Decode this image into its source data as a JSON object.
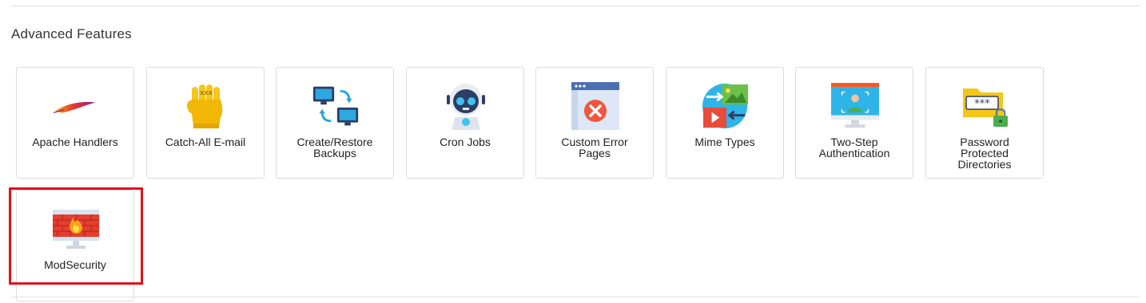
{
  "section": {
    "title": "Advanced Features"
  },
  "tiles": [
    {
      "label": "Apache Handlers",
      "icon": "apache-feather-icon"
    },
    {
      "label": "Catch-All E-mail",
      "icon": "catch-all-hand-icon"
    },
    {
      "label": "Create/Restore\nBackups",
      "icon": "backup-computers-icon"
    },
    {
      "label": "Cron Jobs",
      "icon": "cron-robot-icon"
    },
    {
      "label": "Custom Error\nPages",
      "icon": "error-page-icon"
    },
    {
      "label": "Mime Types",
      "icon": "mime-types-icon"
    },
    {
      "label": "Two-Step\nAuthentication",
      "icon": "two-step-monitor-icon"
    },
    {
      "label": "Password\nProtected\nDirectories",
      "icon": "password-folder-icon"
    },
    {
      "label": "ModSecurity",
      "icon": "firewall-icon"
    }
  ],
  "highlighted_tile": "ModSecurity",
  "colors": {
    "highlight_border": "#e3101b",
    "tile_border": "#dcdcdc"
  }
}
